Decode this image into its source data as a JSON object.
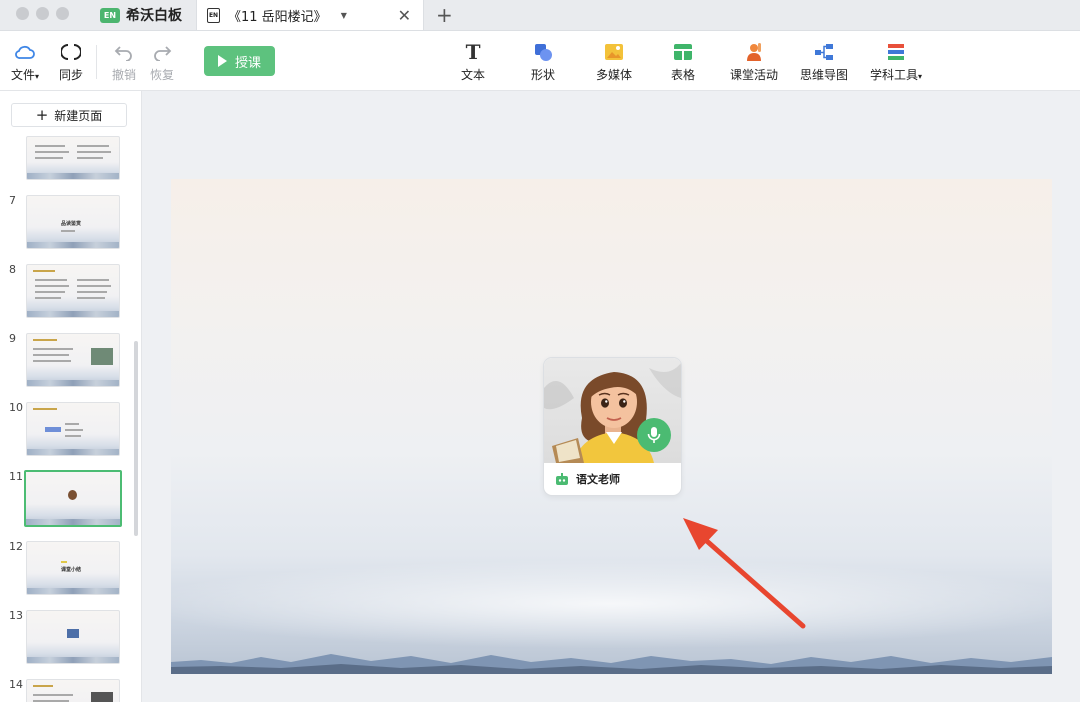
{
  "tabs": {
    "app_title": "希沃白板",
    "app_badge": "EN",
    "doc_title": "《11 岳阳楼记》",
    "doc_badge": "EN"
  },
  "toolbar": {
    "file": "文件",
    "sync": "同步",
    "undo": "撤销",
    "redo": "恢复",
    "teach": "授课",
    "text": "文本",
    "shape": "形状",
    "media": "多媒体",
    "table": "表格",
    "activity": "课堂活动",
    "mindmap": "思维导图",
    "subject_tools": "学科工具"
  },
  "sidebar": {
    "new_page": "新建页面",
    "pages": [
      {
        "num": "",
        "kind": "text2col"
      },
      {
        "num": "7",
        "kind": "title",
        "title": "品读鉴赏"
      },
      {
        "num": "8",
        "kind": "text2col"
      },
      {
        "num": "9",
        "kind": "textpic"
      },
      {
        "num": "10",
        "kind": "diagram"
      },
      {
        "num": "11",
        "kind": "char",
        "active": true
      },
      {
        "num": "12",
        "kind": "title",
        "title": "课堂小结"
      },
      {
        "num": "13",
        "kind": "smallpic"
      },
      {
        "num": "14",
        "kind": "textpic"
      }
    ]
  },
  "canvas": {
    "teacher_name": "语文老师"
  },
  "colors": {
    "accent": "#4bbb72",
    "arrow": "#e8462f"
  }
}
